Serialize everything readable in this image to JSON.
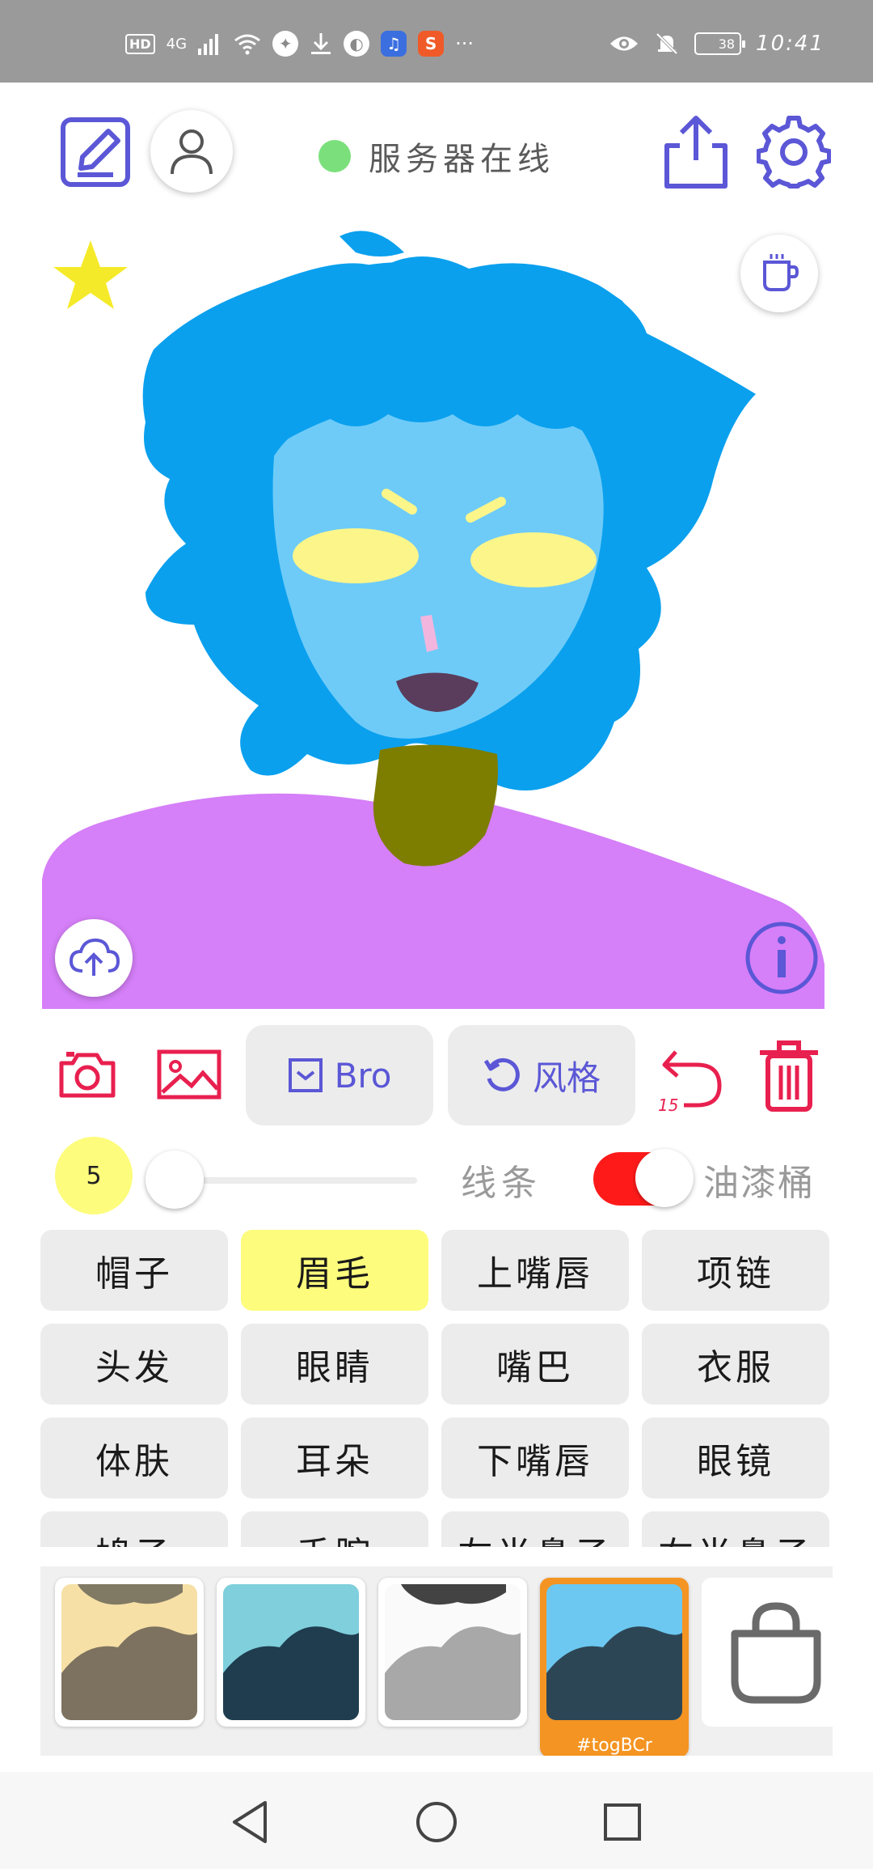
{
  "status_bar": {
    "network_badge": "HD",
    "network_type": "4G",
    "more_indicator": "···",
    "battery_level": "38",
    "time": "10:41",
    "app_icons": [
      "feather-icon",
      "download-icon",
      "browser-icon",
      "music-icon",
      "s-icon"
    ],
    "colors": {
      "music_app": "#3b6fe0",
      "s_app": "#f05a28",
      "feather_app": "#ffffff"
    }
  },
  "header": {
    "server_status": "服务器在线",
    "status_color": "#7be07b",
    "accent_color": "#5b57d6"
  },
  "canvas": {
    "star_color": "#f5ea2a",
    "colors": {
      "hair": "#0aa0ee",
      "skin": "#6ecbf8",
      "eyes": "#fbf58a",
      "brows": "#fbf58a",
      "nose": "#f2b6de",
      "mouth": "#5a3d5c",
      "neck": "#7d7d00",
      "shirt": "#d57ff8"
    }
  },
  "tools": {
    "camera_icon": "camera-icon",
    "image_icon": "image-icon",
    "bro_label": "Bro",
    "style_label": "风格",
    "undo_count": "15",
    "accent_red": "#e8204f"
  },
  "brush": {
    "size": "5",
    "line_label": "线条",
    "bucket_label": "油漆桶",
    "bucket_enabled": true
  },
  "categories": [
    {
      "label": "帽子",
      "active": false
    },
    {
      "label": "眉毛",
      "active": true
    },
    {
      "label": "上嘴唇",
      "active": false
    },
    {
      "label": "项链",
      "active": false
    },
    {
      "label": "头发",
      "active": false
    },
    {
      "label": "眼睛",
      "active": false
    },
    {
      "label": "嘴巴",
      "active": false
    },
    {
      "label": "衣服",
      "active": false
    },
    {
      "label": "体肤",
      "active": false
    },
    {
      "label": "耳朵",
      "active": false
    },
    {
      "label": "下嘴唇",
      "active": false
    },
    {
      "label": "眼镜",
      "active": false
    },
    {
      "label": "鸠子",
      "active": false
    },
    {
      "label": "手腕",
      "active": false
    },
    {
      "label": "左半鼻子",
      "active": false
    },
    {
      "label": "右半鼻子",
      "active": false
    }
  ],
  "palettes": [
    {
      "bg": "#f6e0a6",
      "shape": "#7d7260",
      "top": "#6b6658",
      "selected": false,
      "tag": ""
    },
    {
      "bg": "#7fcfdc",
      "shape": "#1f3d4f",
      "top": "",
      "selected": false,
      "tag": ""
    },
    {
      "bg": "#fafafa",
      "shape": "#a8a8a8",
      "top": "#222222",
      "selected": false,
      "tag": ""
    },
    {
      "bg": "#6cc8f0",
      "shape": "#2d4656",
      "top": "",
      "selected": true,
      "tag": "#togBCr"
    }
  ]
}
